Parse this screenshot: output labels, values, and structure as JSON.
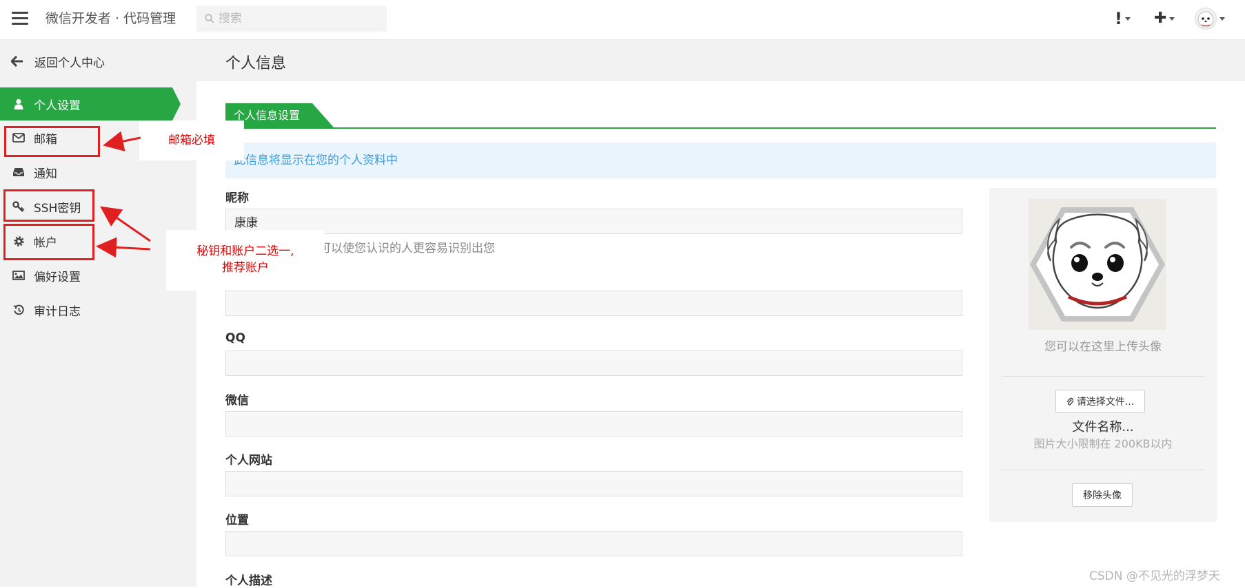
{
  "header": {
    "title": "微信开发者 · 代码管理",
    "search_placeholder": "搜索",
    "notification_glyph": "!",
    "create_glyph": "✚"
  },
  "sidebar": {
    "back_label": "返回个人中心",
    "items": [
      {
        "label": "个人设置",
        "icon": "user-icon",
        "active": true
      },
      {
        "label": "邮箱",
        "icon": "envelope-icon"
      },
      {
        "label": "通知",
        "icon": "inbox-icon"
      },
      {
        "label": "SSH密钥",
        "icon": "key-icon"
      },
      {
        "label": "帐户",
        "icon": "gear-icon"
      },
      {
        "label": "偏好设置",
        "icon": "image-icon"
      },
      {
        "label": "审计日志",
        "icon": "history-icon"
      }
    ]
  },
  "main": {
    "page_title": "个人信息",
    "section_tab": "个人信息设置",
    "info_text": "此信息将显示在您的个人资料中",
    "fields": {
      "nickname": {
        "label": "昵称",
        "value": "康康",
        "help": "使用您的真实姓名可以使您认识的人更容易识别出您"
      },
      "email": {
        "label": "",
        "value": ""
      },
      "qq": {
        "label": "QQ",
        "value": ""
      },
      "wechat": {
        "label": "微信",
        "value": ""
      },
      "website": {
        "label": "个人网站",
        "value": ""
      },
      "location": {
        "label": "位置",
        "value": ""
      },
      "description": {
        "label": "个人描述"
      }
    }
  },
  "avatar_panel": {
    "hint": "您可以在这里上传头像",
    "choose_file": "请选择文件...",
    "file_name": "文件名称...",
    "size_limit": "图片大小限制在 200KB以内",
    "remove": "移除头像"
  },
  "annotations": {
    "email_note": "邮箱必填",
    "key_account_note_line1": "秘钥和账户二选一,",
    "key_account_note_line2": "推荐账户",
    "color": "#e02020"
  },
  "watermark": "CSDN @不见光的浮梦天",
  "colors": {
    "accent": "#27a744",
    "info_bg": "#e9f4fd",
    "info_text": "#3c9ad8"
  }
}
